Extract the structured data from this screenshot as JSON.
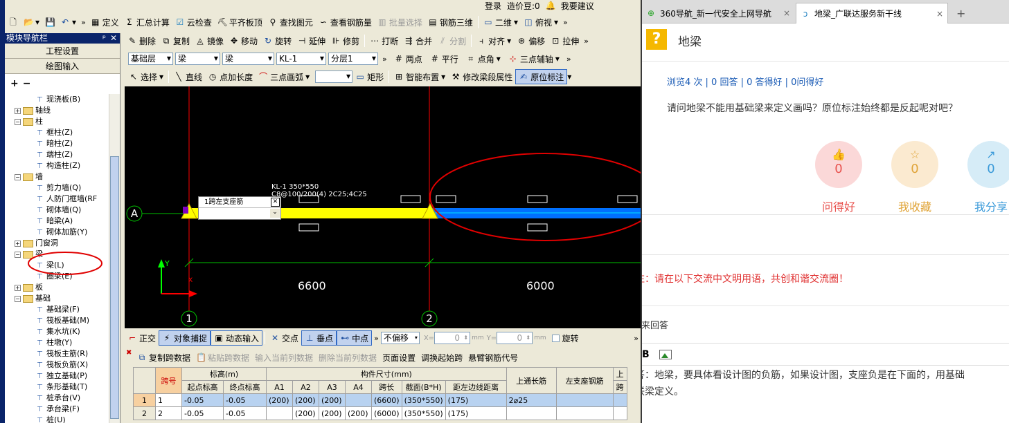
{
  "cad": {
    "titlebar": {
      "login": "登录",
      "price": "造价豆:0",
      "suggest": "我要建议"
    },
    "toolbar1": {
      "define": "定义",
      "calc": "汇总计算",
      "cloud": "云检查",
      "flatten": "平齐板顶",
      "find": "查找图元",
      "rebar": "查看钢筋量",
      "batch": "批量选择",
      "rebar3d": "钢筋三维",
      "view2d": "二维",
      "viewtop": "俯视"
    },
    "toolbar2": {
      "delete": "删除",
      "copy": "复制",
      "mirror": "镜像",
      "move": "移动",
      "rotate": "旋转",
      "extend": "延伸",
      "trim": "修剪",
      "break": "打断",
      "merge": "合并",
      "split": "分割",
      "align": "对齐",
      "offset": "偏移",
      "stretch": "拉伸"
    },
    "toolbar3": {
      "floor": "基础层",
      "type": "梁",
      "sub": "梁",
      "name": "KL-1",
      "layer": "分层1",
      "twopoint": "两点",
      "parallel": "平行",
      "pointangle": "点角",
      "threepoint": "三点辅轴"
    },
    "toolbar4": {
      "select": "选择",
      "line": "直线",
      "pointlen": "点加长度",
      "arc": "三点画弧",
      "rect": "矩形",
      "smart": "智能布置",
      "modify": "修改梁段属性",
      "origin": "原位标注"
    },
    "nav": {
      "title": "模块导航栏",
      "pin": "ᵖ",
      "close": "✕",
      "add": "+",
      "remove": "−",
      "btn_project": "工程设置",
      "btn_draw": "绘图输入",
      "items": [
        {
          "level": 2,
          "label": "现浇板(B)"
        },
        {
          "level": 1,
          "label": "轴线",
          "toggle": "+"
        },
        {
          "level": 1,
          "label": "柱",
          "toggle": "−"
        },
        {
          "level": 2,
          "label": "框柱(Z)"
        },
        {
          "level": 2,
          "label": "暗柱(Z)"
        },
        {
          "level": 2,
          "label": "端柱(Z)"
        },
        {
          "level": 2,
          "label": "构造柱(Z)"
        },
        {
          "level": 1,
          "label": "墙",
          "toggle": "−"
        },
        {
          "level": 2,
          "label": "剪力墙(Q)"
        },
        {
          "level": 2,
          "label": "人防门框墙(RF"
        },
        {
          "level": 2,
          "label": "砌体墙(Q)"
        },
        {
          "level": 2,
          "label": "暗梁(A)"
        },
        {
          "level": 2,
          "label": "砌体加筋(Y)"
        },
        {
          "level": 1,
          "label": "门窗洞",
          "toggle": "+"
        },
        {
          "level": 1,
          "label": "梁",
          "toggle": "−"
        },
        {
          "level": 2,
          "label": "梁(L)"
        },
        {
          "level": 2,
          "label": "圈梁(E)"
        },
        {
          "level": 1,
          "label": "板",
          "toggle": "+"
        },
        {
          "level": 1,
          "label": "基础",
          "toggle": "−"
        },
        {
          "level": 2,
          "label": "基础梁(F)"
        },
        {
          "level": 2,
          "label": "筏板基础(M)"
        },
        {
          "level": 2,
          "label": "集水坑(K)"
        },
        {
          "level": 2,
          "label": "柱墩(Y)"
        },
        {
          "level": 2,
          "label": "筏板主筋(R)"
        },
        {
          "level": 2,
          "label": "筏板负筋(X)"
        },
        {
          "level": 2,
          "label": "独立基础(P)"
        },
        {
          "level": 2,
          "label": "条形基础(T)"
        },
        {
          "level": 2,
          "label": "桩承台(V)"
        },
        {
          "level": 2,
          "label": "承台梁(F)"
        },
        {
          "level": 2,
          "label": "桩(U)"
        }
      ]
    },
    "canvas": {
      "axis_a": "A",
      "axis_1": "1",
      "axis_2": "2",
      "dim1": "6600",
      "dim2": "6000",
      "beam_label1": "KL-1 350*550",
      "beam_label2": "C8@100/200(4) 2C25;4C25",
      "popup_title": "1跨左支座筋",
      "popup_close": "✕",
      "popup_arrow": "⌄",
      "ucs_y": "Y",
      "ucs_x": "X"
    },
    "snapbar": {
      "ortho": "正交",
      "snap": "对象捕捉",
      "dyn": "动态输入",
      "intersect": "交点",
      "perp": "垂点",
      "mid": "中点",
      "offset": "不偏移",
      "x_label": "X=",
      "x_val": "0",
      "y_label": "Y=",
      "y_val": "0",
      "unit": "mm",
      "rotate": "旋转"
    },
    "tabletools": {
      "copy": "复制跨数据",
      "paste": "粘贴跨数据",
      "input": "输入当前列数据",
      "delete": "删除当前列数据",
      "page": "页面设置",
      "swap": "调换起始跨",
      "cant": "悬臂钢筋代号"
    },
    "table": {
      "h_span": "跨号",
      "h_elev": "标高(m)",
      "h_dims": "构件尺寸(mm)",
      "h_top": "上通长筋",
      "h_leftbar": "左支座钢筋",
      "h_right": "上",
      "h_start": "起点标高",
      "h_end": "终点标高",
      "h_a1": "A1",
      "h_a2": "A2",
      "h_a3": "A3",
      "h_a4": "A4",
      "h_len": "跨长",
      "h_sec": "截面(B*H)",
      "h_dist": "距左边线距离",
      "h_cut": "跨",
      "rows": [
        {
          "idx": "1",
          "span": "1",
          "start": "-0.05",
          "end": "-0.05",
          "a1": "(200)",
          "a2": "(200)",
          "a3": "(200)",
          "a4": "",
          "len": "(6600)",
          "sec": "(350*550)",
          "dist": "(175)",
          "top": "2⌀25",
          "left": ""
        },
        {
          "idx": "2",
          "span": "2",
          "start": "-0.05",
          "end": "-0.05",
          "a1": "",
          "a2": "(200)",
          "a3": "(200)",
          "a4": "(200)",
          "len": "(6000)",
          "sec": "(350*550)",
          "dist": "(175)",
          "top": "",
          "left": ""
        }
      ]
    }
  },
  "browser": {
    "tab1": "360导航_新一代安全上网导航",
    "tab2": "地梁_广联达服务新干线",
    "newtab": "+",
    "close": "×",
    "q_icon": "?",
    "q_title": "地梁",
    "stats": "浏览4 次 | 0 回答 | 0 答得好 | 0问得好",
    "q_text": "请问地梁不能用基础梁来定义画吗？原位标注始终都是反起呢对吧？",
    "actions": [
      {
        "label": "问得好",
        "count": "0",
        "color": "#e8534f",
        "bg": "#fbd8d8"
      },
      {
        "label": "我收藏",
        "count": "0",
        "color": "#e0a438",
        "bg": "#fbead0"
      },
      {
        "label": "我分享",
        "count": "0",
        "color": "#3a9ad9",
        "bg": "#d6ecf7"
      }
    ],
    "notice": "注：请在以下交流中文明用语，共创和谐交流圈！",
    "answer_prompt": "我来回答",
    "bold": "B",
    "answer": "答：地梁，要具体看设计图的负筋，如果设计图，支座负是在下面的，用基础联梁定义。",
    "answer_line1": "答：地梁，要具体看设计图的负筋，如果设计图，支座负是在下面的，用基础",
    "answer_line2": "联梁定义。"
  },
  "colors": {
    "beam_yellow": "#ffff00",
    "beam_blue": "#0070ff",
    "axis_red": "#ff0000",
    "notice_red": "#e03030",
    "link_blue": "#1a5bb5"
  }
}
